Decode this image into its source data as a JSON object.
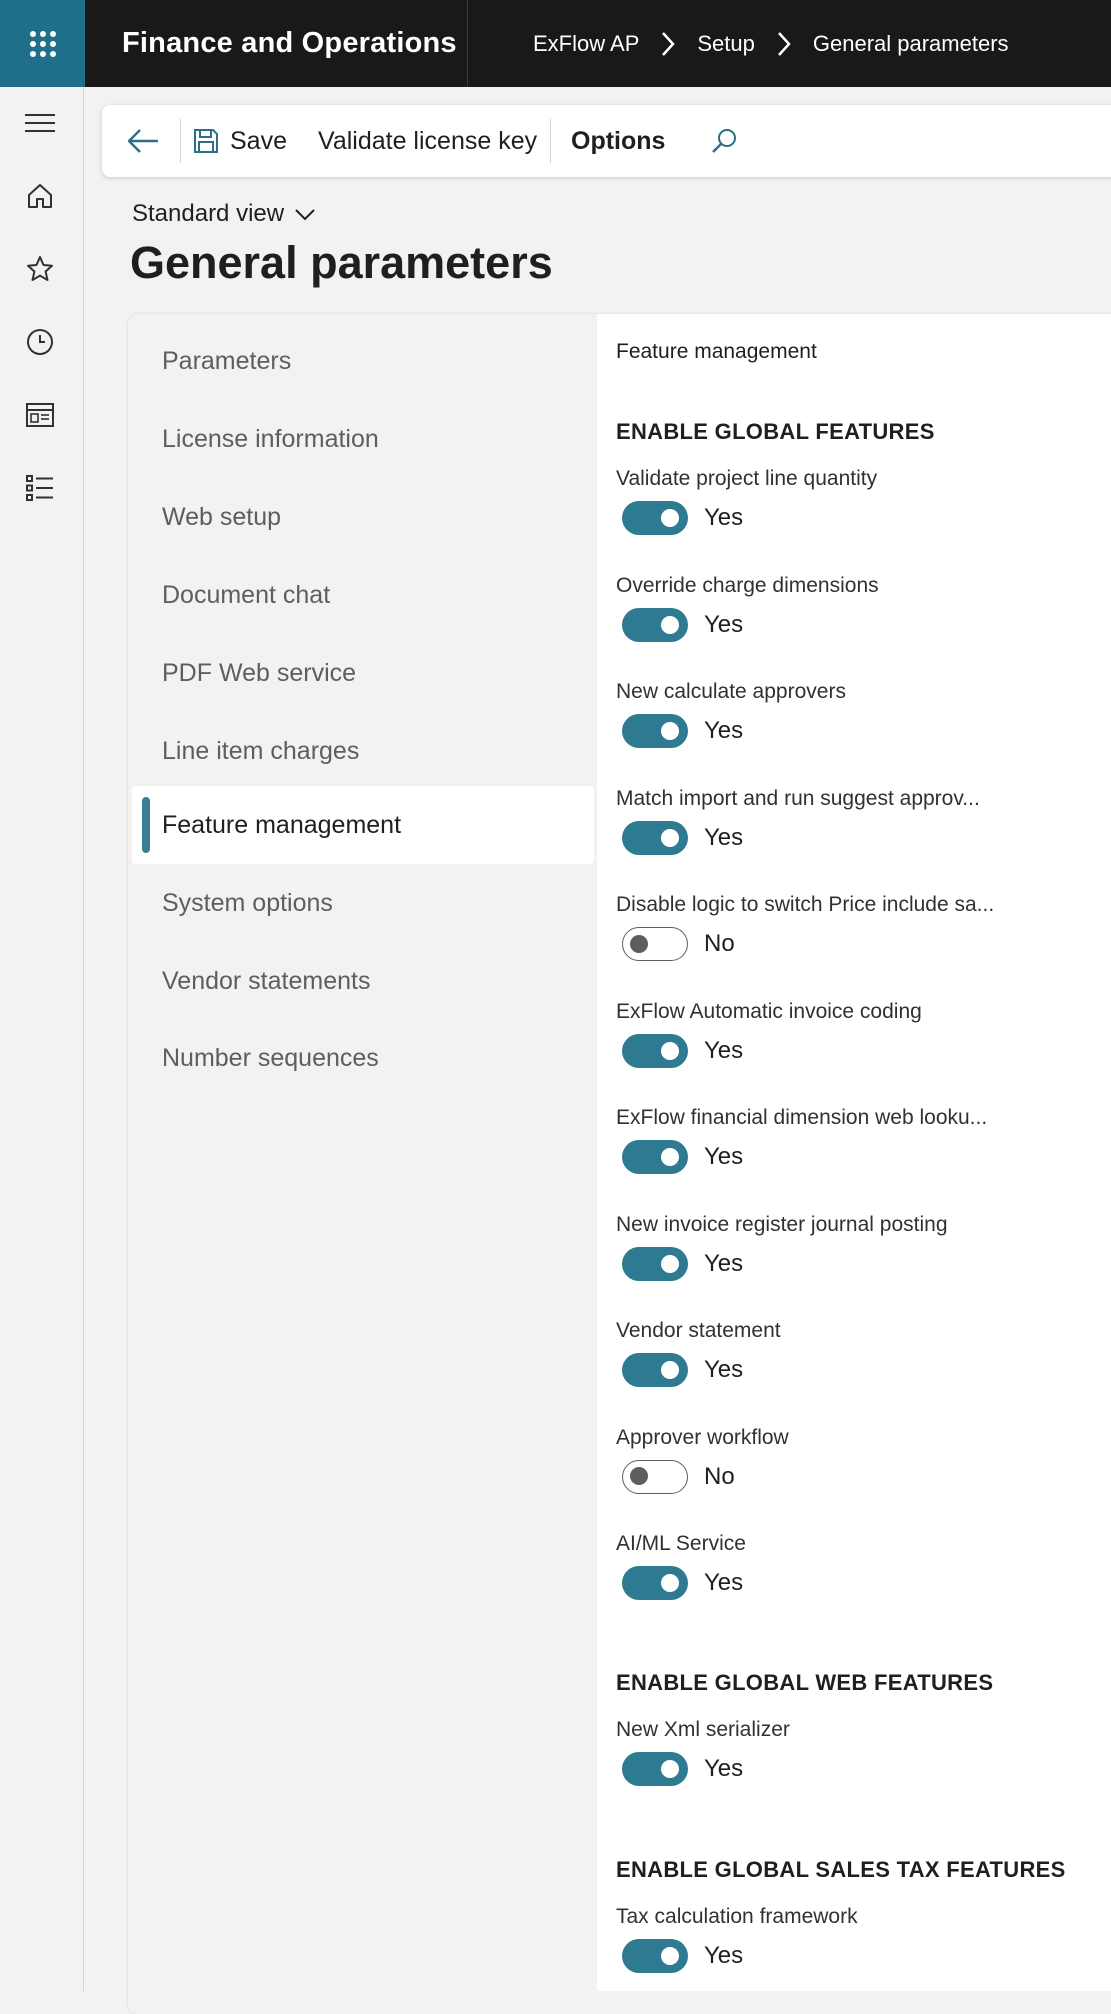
{
  "app": {
    "title": "Finance and Operations"
  },
  "breadcrumb": [
    "ExFlow AP",
    "Setup",
    "General parameters"
  ],
  "toolbar": {
    "save_label": "Save",
    "validate_label": "Validate license key",
    "options_label": "Options"
  },
  "view": {
    "label": "Standard view"
  },
  "page": {
    "title": "General parameters"
  },
  "tabs": [
    "Parameters",
    "License information",
    "Web setup",
    "Document chat",
    "PDF Web service",
    "Line item charges",
    "Feature management",
    "System options",
    "Vendor statements",
    "Number sequences"
  ],
  "active_tab_index": 6,
  "content": {
    "section_crumb": "Feature management",
    "groups": [
      {
        "title": "ENABLE GLOBAL FEATURES",
        "features": [
          {
            "label": "Validate project line quantity",
            "state": "Yes"
          },
          {
            "label": "Override charge dimensions",
            "state": "Yes"
          },
          {
            "label": "New calculate approvers",
            "state": "Yes"
          },
          {
            "label": "Match import and run suggest approv...",
            "state": "Yes"
          },
          {
            "label": "Disable logic to switch Price include sa...",
            "state": "No"
          },
          {
            "label": "ExFlow Automatic invoice coding",
            "state": "Yes"
          },
          {
            "label": "ExFlow financial dimension web looku...",
            "state": "Yes"
          },
          {
            "label": "New invoice register journal posting",
            "state": "Yes"
          },
          {
            "label": "Vendor statement",
            "state": "Yes"
          },
          {
            "label": "Approver workflow",
            "state": "No"
          },
          {
            "label": "AI/ML Service",
            "state": "Yes"
          }
        ]
      },
      {
        "title": "ENABLE GLOBAL WEB FEATURES",
        "features": [
          {
            "label": "New Xml serializer",
            "state": "Yes"
          }
        ]
      },
      {
        "title": "ENABLE GLOBAL SALES TAX FEATURES",
        "features": [
          {
            "label": "Tax calculation framework",
            "state": "Yes"
          }
        ]
      }
    ]
  },
  "colors": {
    "accent": "#2e7a91",
    "topbar": "#1a1918",
    "waffle": "#1f6f8b"
  }
}
